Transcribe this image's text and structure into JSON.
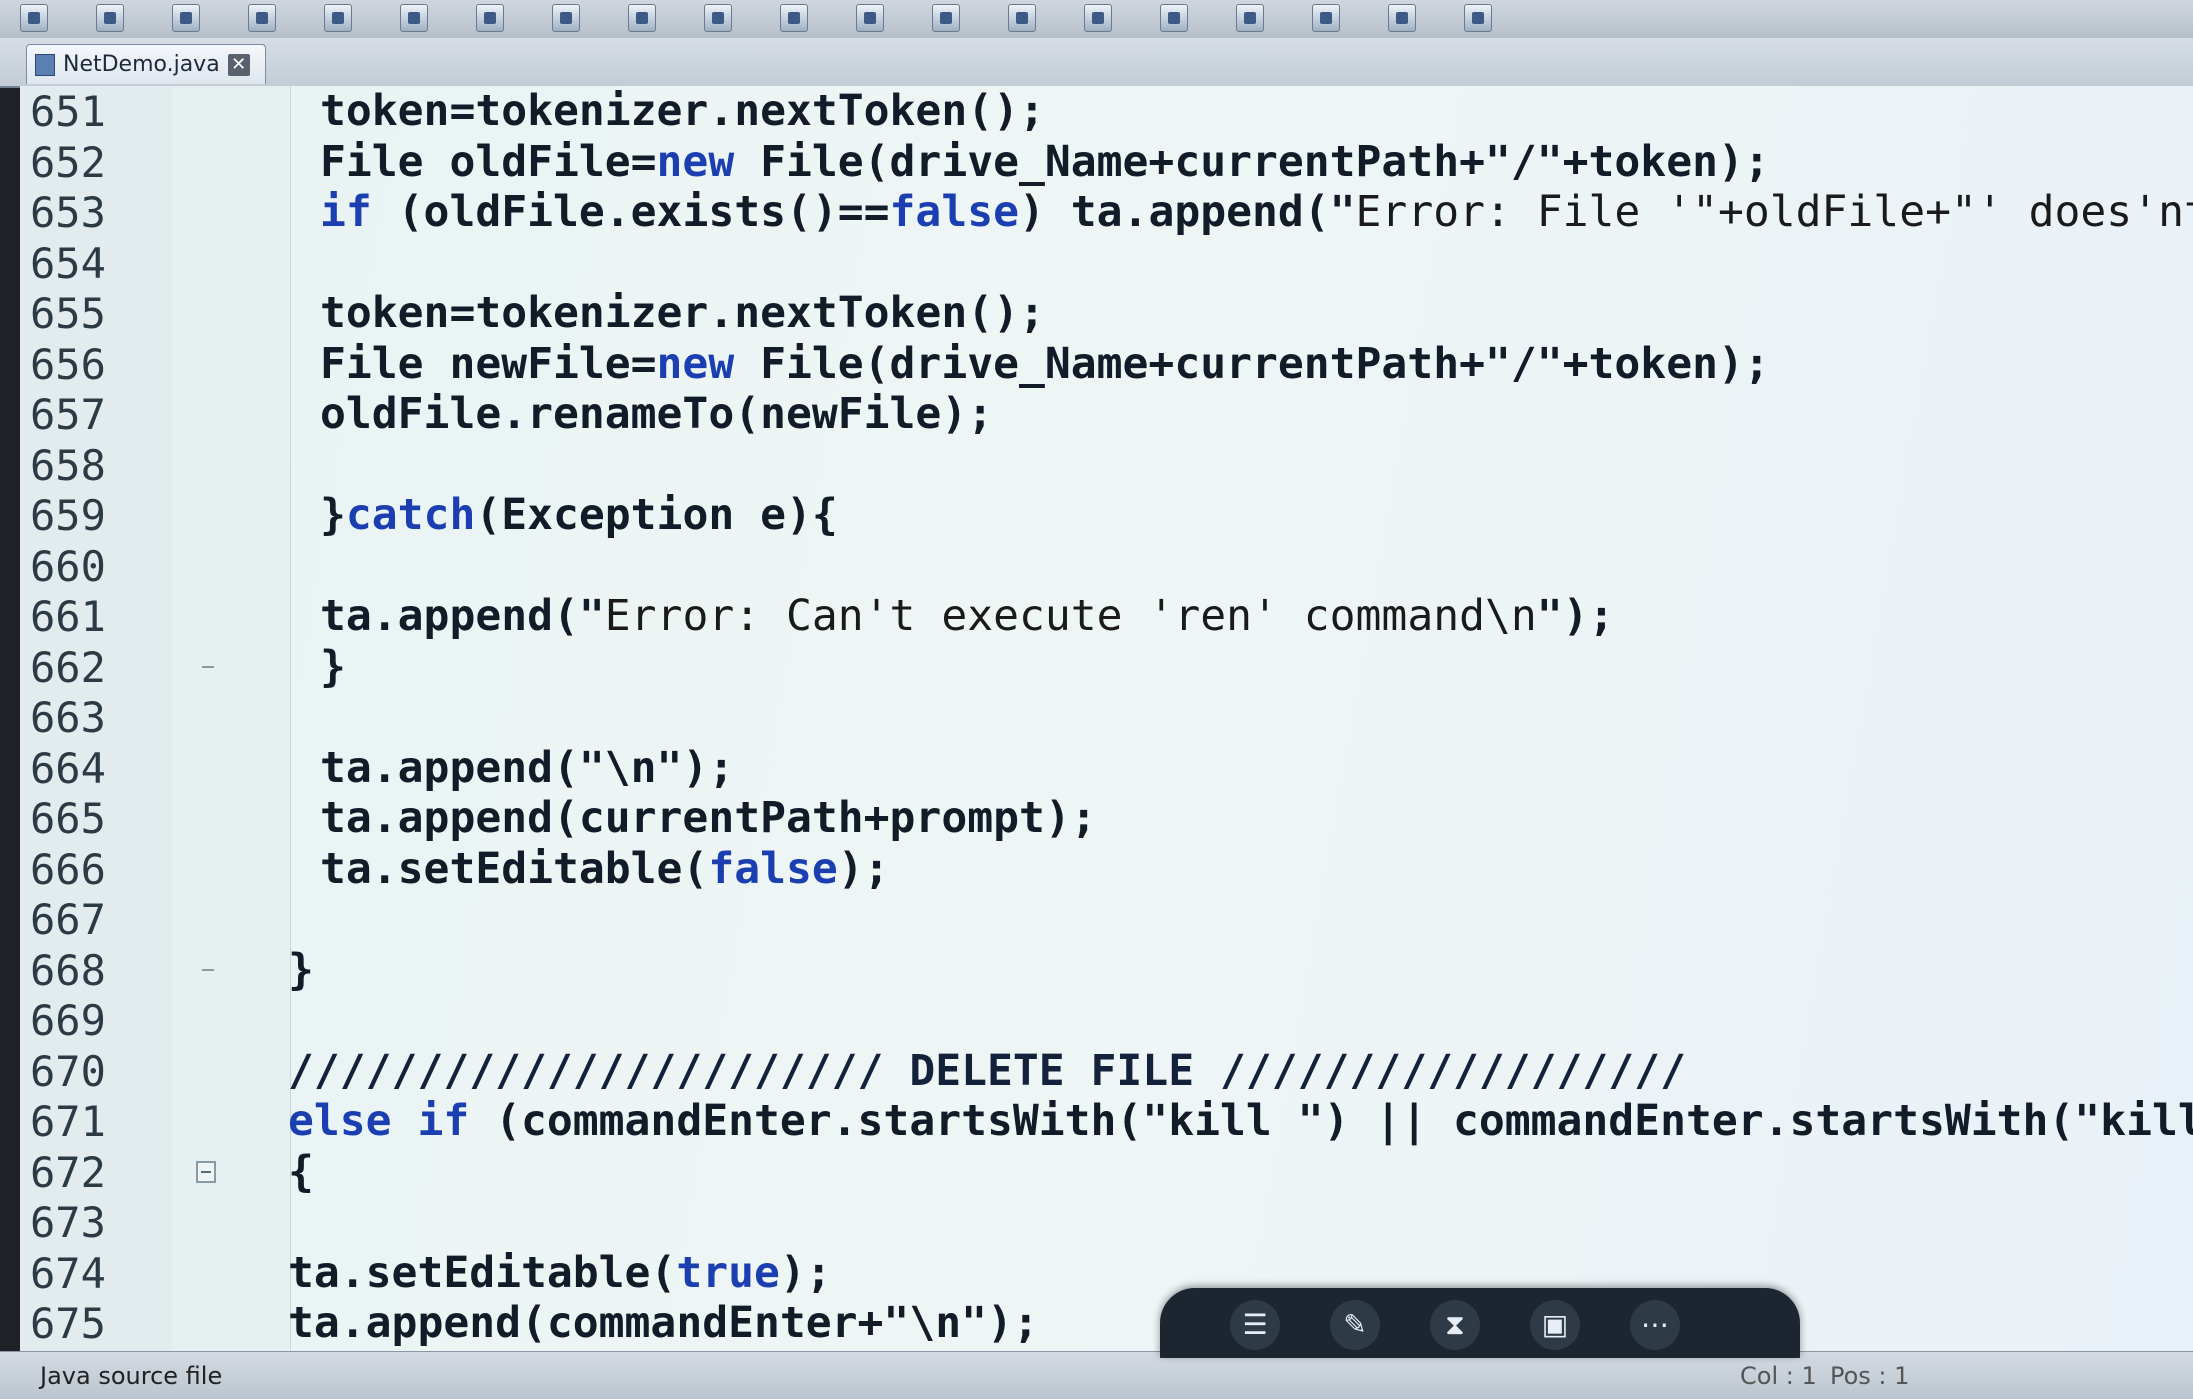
{
  "editor": {
    "tab": {
      "label": "NetDemo.java"
    },
    "lines": [
      {
        "num": "651",
        "indent": 4,
        "fold": "",
        "parts": [
          {
            "t": "token=tokenizer.nextToken();",
            "c": "id"
          }
        ]
      },
      {
        "num": "652",
        "indent": 4,
        "fold": "",
        "parts": [
          {
            "t": "File oldFile=",
            "c": "id"
          },
          {
            "t": "new",
            "c": "kw"
          },
          {
            "t": " File(drive_Name+currentPath+\"/\"+token);",
            "c": "id"
          }
        ]
      },
      {
        "num": "653",
        "indent": 4,
        "fold": "",
        "parts": [
          {
            "t": "if",
            "c": "kw"
          },
          {
            "t": " (oldFile.exists()==",
            "c": "id"
          },
          {
            "t": "false",
            "c": "kw"
          },
          {
            "t": ") ta.append(\"",
            "c": "id"
          },
          {
            "t": "Error: File '\"+oldFile+\"' does'nt exist\\n",
            "c": "str"
          },
          {
            "t": "\");",
            "c": "id"
          }
        ]
      },
      {
        "num": "654",
        "indent": 0,
        "fold": "",
        "parts": []
      },
      {
        "num": "655",
        "indent": 4,
        "fold": "",
        "parts": [
          {
            "t": "token=tokenizer.nextToken();",
            "c": "id"
          }
        ]
      },
      {
        "num": "656",
        "indent": 4,
        "fold": "",
        "parts": [
          {
            "t": "File newFile=",
            "c": "id"
          },
          {
            "t": "new",
            "c": "kw"
          },
          {
            "t": " File(drive_Name+currentPath+\"/\"+token);",
            "c": "id"
          }
        ]
      },
      {
        "num": "657",
        "indent": 4,
        "fold": "",
        "parts": [
          {
            "t": "oldFile.renameTo(newFile);",
            "c": "id"
          }
        ]
      },
      {
        "num": "658",
        "indent": 0,
        "fold": "",
        "parts": []
      },
      {
        "num": "659",
        "indent": 4,
        "fold": "",
        "parts": [
          {
            "t": "}",
            "c": "id"
          },
          {
            "t": "catch",
            "c": "kw"
          },
          {
            "t": "(Exception e){",
            "c": "id"
          }
        ]
      },
      {
        "num": "660",
        "indent": 0,
        "fold": "",
        "parts": []
      },
      {
        "num": "661",
        "indent": 4,
        "fold": "",
        "parts": [
          {
            "t": "ta.append(\"",
            "c": "id"
          },
          {
            "t": "Error: Can't execute 'ren' command\\n",
            "c": "str"
          },
          {
            "t": "\");",
            "c": "id"
          }
        ]
      },
      {
        "num": "662",
        "indent": 4,
        "fold": "end",
        "parts": [
          {
            "t": "}",
            "c": "id"
          }
        ]
      },
      {
        "num": "663",
        "indent": 0,
        "fold": "",
        "parts": []
      },
      {
        "num": "664",
        "indent": 4,
        "fold": "",
        "parts": [
          {
            "t": "ta.append(\"\\n\");",
            "c": "id"
          }
        ]
      },
      {
        "num": "665",
        "indent": 4,
        "fold": "",
        "parts": [
          {
            "t": "ta.append(currentPath+prompt);",
            "c": "id"
          }
        ]
      },
      {
        "num": "666",
        "indent": 4,
        "fold": "",
        "parts": [
          {
            "t": "ta.setEditable(",
            "c": "id"
          },
          {
            "t": "false",
            "c": "kw"
          },
          {
            "t": ");",
            "c": "id"
          }
        ]
      },
      {
        "num": "667",
        "indent": 0,
        "fold": "",
        "parts": []
      },
      {
        "num": "668",
        "indent": 3,
        "fold": "end",
        "parts": [
          {
            "t": "}",
            "c": "id"
          }
        ]
      },
      {
        "num": "669",
        "indent": 0,
        "fold": "",
        "parts": []
      },
      {
        "num": "670",
        "indent": 3,
        "fold": "",
        "parts": [
          {
            "t": "/////////////////////// DELETE FILE //////////////////",
            "c": "cm"
          }
        ]
      },
      {
        "num": "671",
        "indent": 3,
        "fold": "",
        "parts": [
          {
            "t": "else if",
            "c": "kw"
          },
          {
            "t": " (commandEnter.startsWith(\"kill \") || commandEnter.startsWith(\"kill\"))",
            "c": "id"
          }
        ]
      },
      {
        "num": "672",
        "indent": 3,
        "fold": "start",
        "parts": [
          {
            "t": "{",
            "c": "id"
          }
        ]
      },
      {
        "num": "673",
        "indent": 0,
        "fold": "",
        "parts": []
      },
      {
        "num": "674",
        "indent": 3,
        "fold": "",
        "parts": [
          {
            "t": "ta.setEditable(",
            "c": "id"
          },
          {
            "t": "true",
            "c": "kw"
          },
          {
            "t": ");",
            "c": "id"
          }
        ]
      },
      {
        "num": "675",
        "indent": 3,
        "fold": "",
        "parts": [
          {
            "t": "ta.append(commandEnter+\"\\n\");",
            "c": "id"
          }
        ]
      }
    ]
  },
  "status": {
    "file_type": "Java source file",
    "col": "Col : 1",
    "pos": "Pos : 1"
  },
  "colors": {
    "keyword": "#1b3fb0",
    "text": "#111c28",
    "background": "#e8f2f3"
  },
  "toolbar_icons": [
    "new-file-icon",
    "open-icon",
    "save-icon",
    "save-all-icon",
    "undo-icon",
    "redo-icon",
    "cut-icon",
    "copy-icon",
    "paste-icon",
    "find-icon",
    "replace-icon",
    "indent-icon",
    "outdent-icon",
    "compile-icon",
    "run-icon",
    "debug-icon",
    "stop-icon",
    "step-icon",
    "build-icon",
    "window-icon"
  ],
  "floatbar_icons": [
    "menu-icon",
    "pen-icon",
    "hourglass-icon",
    "image-icon",
    "more-icon"
  ]
}
